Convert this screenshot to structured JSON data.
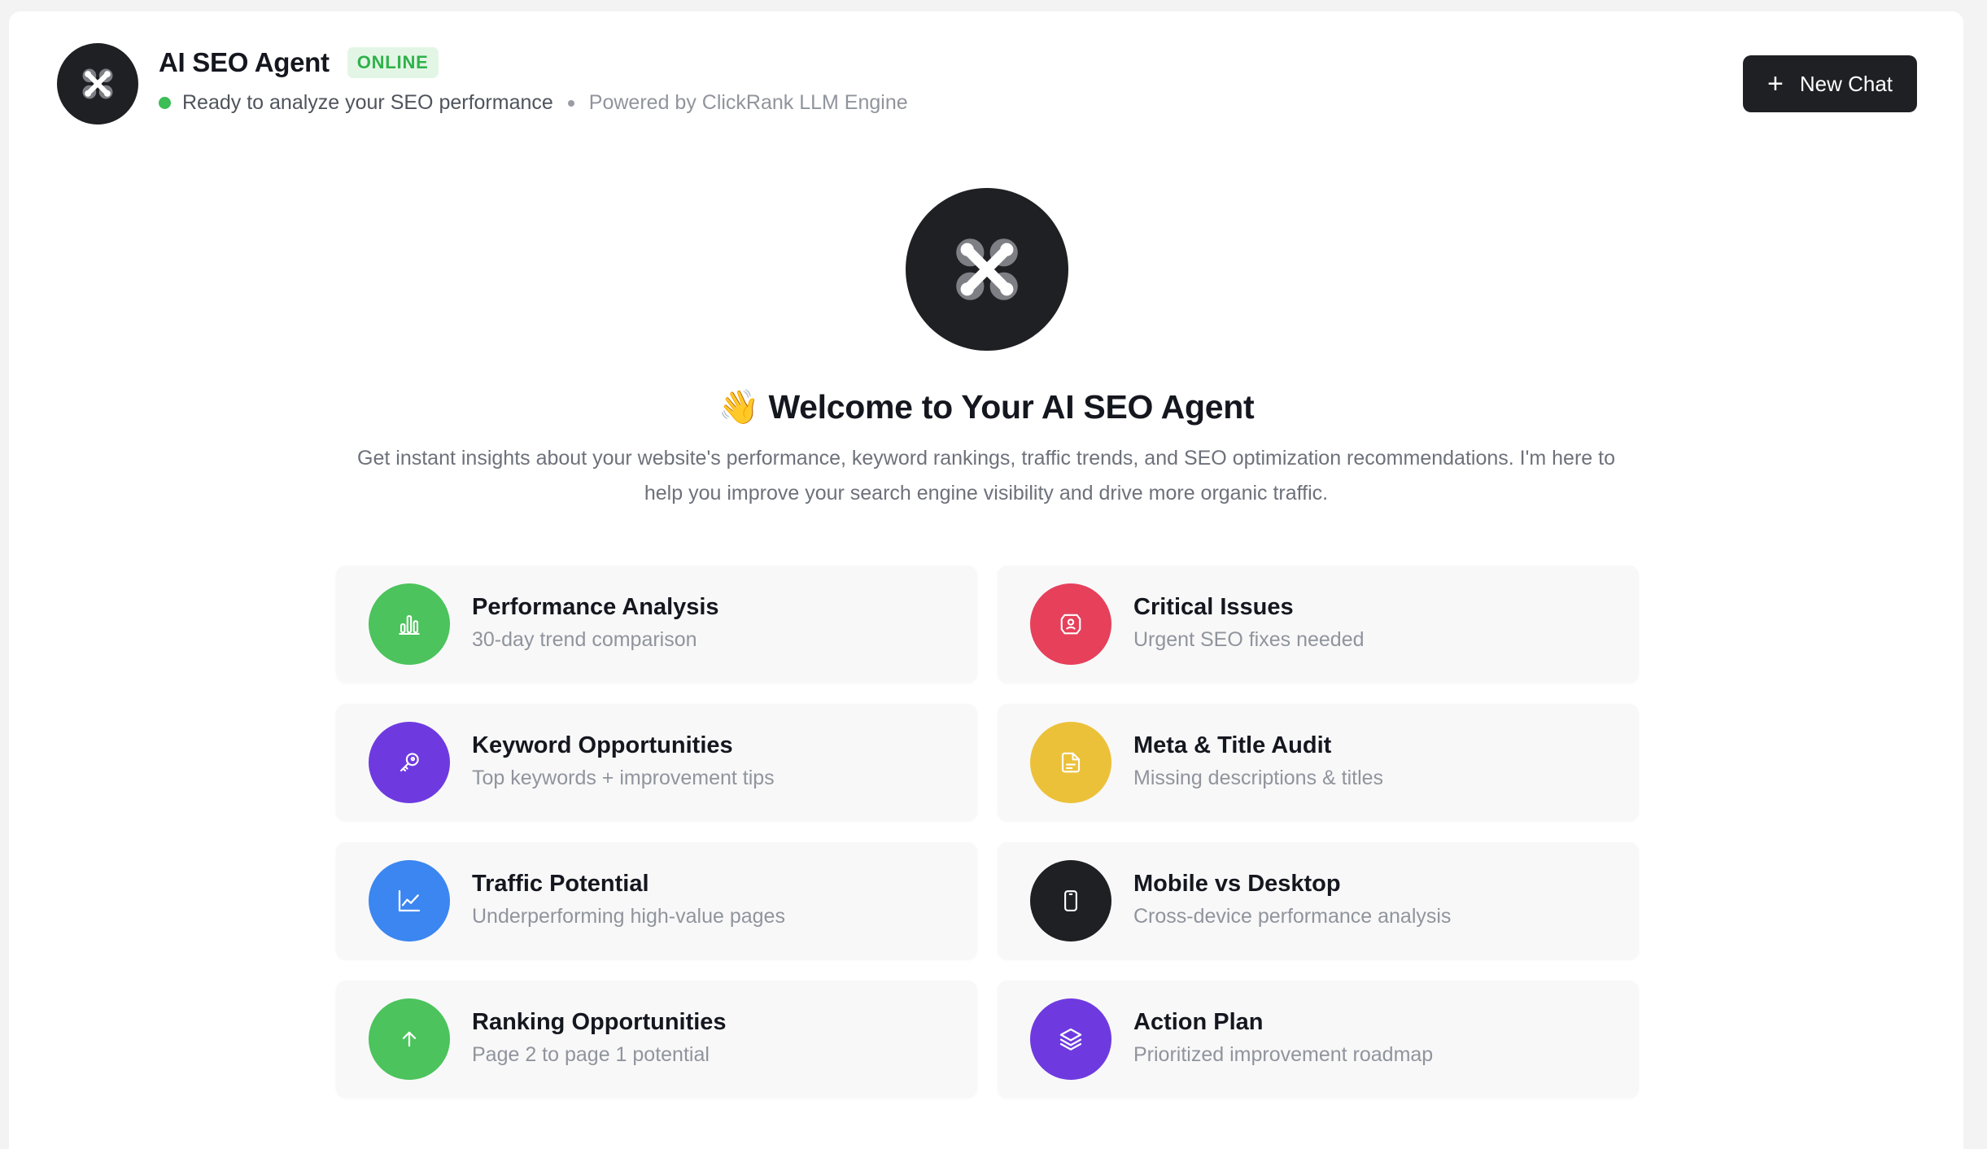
{
  "header": {
    "title": "AI SEO Agent",
    "badge": "ONLINE",
    "status": "Ready to analyze your SEO performance",
    "powered_by": "Powered by ClickRank LLM Engine",
    "new_chat_label": "New Chat",
    "new_chat_icon": "plus-icon"
  },
  "hero": {
    "emoji": "👋",
    "title": "Welcome to Your AI SEO Agent",
    "description": "Get instant insights about your website's performance, keyword rankings, traffic trends, and SEO optimization recommendations. I'm here to help you improve your search engine visibility and drive more organic traffic."
  },
  "cards": [
    {
      "title": "Performance Analysis",
      "description": "30-day trend comparison",
      "icon": "bar-chart-icon",
      "color": "#4cc35c"
    },
    {
      "title": "Critical Issues",
      "description": "Urgent SEO fixes needed",
      "icon": "shield-alert-icon",
      "color": "#e6405b"
    },
    {
      "title": "Keyword Opportunities",
      "description": "Top keywords + improvement tips",
      "icon": "key-icon",
      "color": "#6e3ae0"
    },
    {
      "title": "Meta & Title Audit",
      "description": "Missing descriptions & titles",
      "icon": "document-icon",
      "color": "#ecc13a"
    },
    {
      "title": "Traffic Potential",
      "description": "Underperforming high-value pages",
      "icon": "line-chart-icon",
      "color": "#3b86f0"
    },
    {
      "title": "Mobile vs Desktop",
      "description": "Cross-device performance analysis",
      "icon": "smartphone-icon",
      "color": "#1f2024"
    },
    {
      "title": "Ranking Opportunities",
      "description": "Page 2 to page 1 potential",
      "icon": "arrow-up-icon",
      "color": "#4cc35c"
    },
    {
      "title": "Action Plan",
      "description": "Prioritized improvement roadmap",
      "icon": "layers-icon",
      "color": "#6e3ae0"
    }
  ]
}
